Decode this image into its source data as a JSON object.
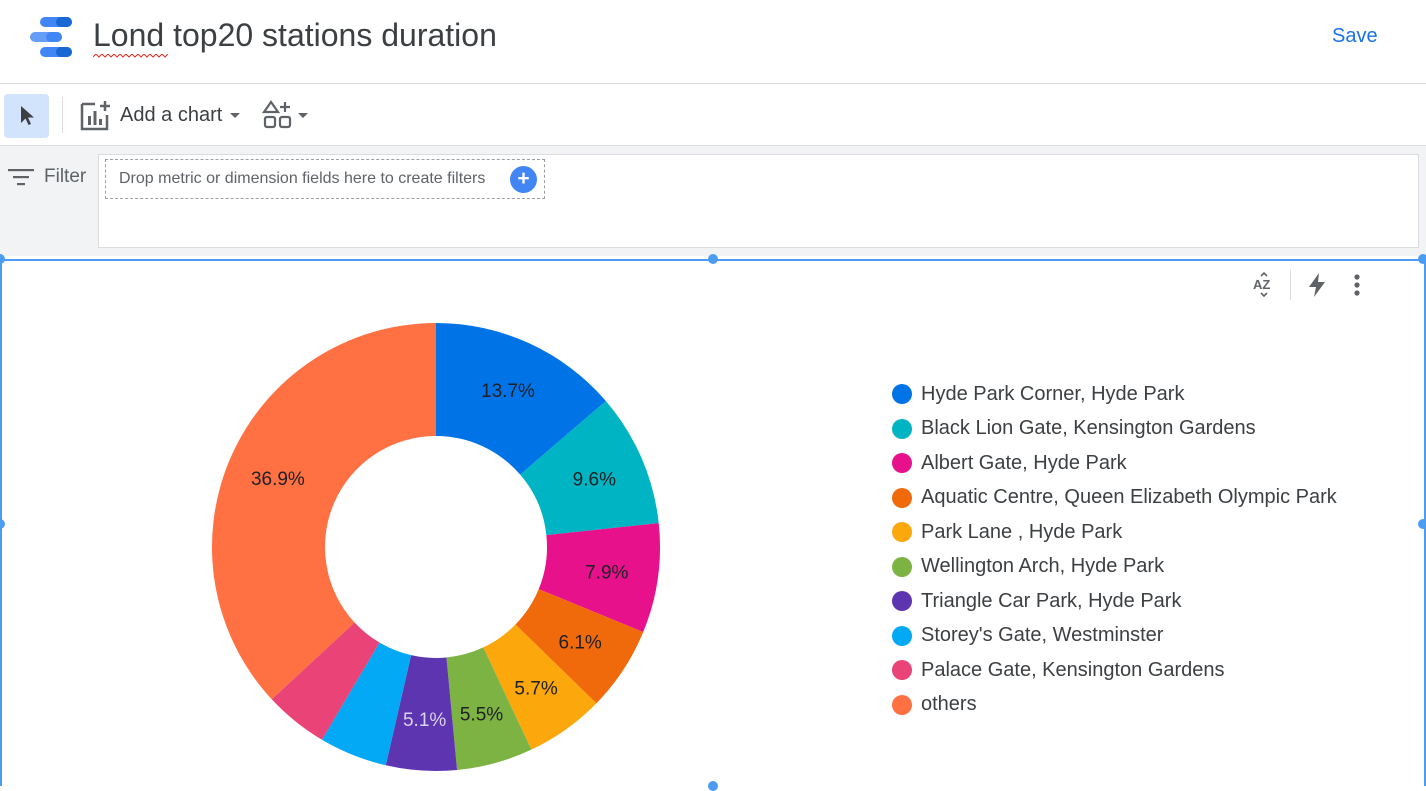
{
  "header": {
    "title": "Lond top20 stations duration",
    "save_label": "Save",
    "logo_icon": "looker-studio-logo-icon"
  },
  "toolbar": {
    "select_icon": "cursor-arrow-icon",
    "add_chart_label": "Add a chart",
    "add_control_icon": "add-control-icon"
  },
  "filter": {
    "label": "Filter",
    "placeholder": "Drop metric or dimension fields here to create filters",
    "add_icon": "+"
  },
  "chart_icons": [
    "sort-az-icon",
    "lightning-icon",
    "more-vert-icon"
  ],
  "chart_data": {
    "type": "pie",
    "donut": true,
    "legend_position": "right",
    "slices": [
      {
        "label": "Hyde Park Corner, Hyde Park",
        "value": 13.7,
        "display": "13.7%",
        "color": "#0073e6"
      },
      {
        "label": "Black Lion Gate, Kensington Gardens",
        "value": 9.6,
        "display": "9.6%",
        "color": "#00b4c4"
      },
      {
        "label": "Albert Gate, Hyde Park",
        "value": 7.9,
        "display": "7.9%",
        "color": "#e8118c"
      },
      {
        "label": "Aquatic Centre, Queen Elizabeth Olympic Park",
        "value": 6.1,
        "display": "6.1%",
        "color": "#f06a0c"
      },
      {
        "label": "Park Lane , Hyde Park",
        "value": 5.7,
        "display": "5.7%",
        "color": "#fca70c"
      },
      {
        "label": "Wellington Arch, Hyde Park",
        "value": 5.5,
        "display": "5.5%",
        "color": "#7cb342"
      },
      {
        "label": "Triangle Car Park, Hyde Park",
        "value": 5.1,
        "display": "5.1%",
        "color": "#5e35b1"
      },
      {
        "label": "Storey's Gate, Westminster",
        "value": 4.9,
        "display": "",
        "color": "#03a9f4"
      },
      {
        "label": "Palace Gate, Kensington Gardens",
        "value": 4.6,
        "display": "",
        "color": "#e94377"
      },
      {
        "label": "others",
        "value": 36.9,
        "display": "36.9%",
        "color": "#ff7043"
      }
    ]
  }
}
